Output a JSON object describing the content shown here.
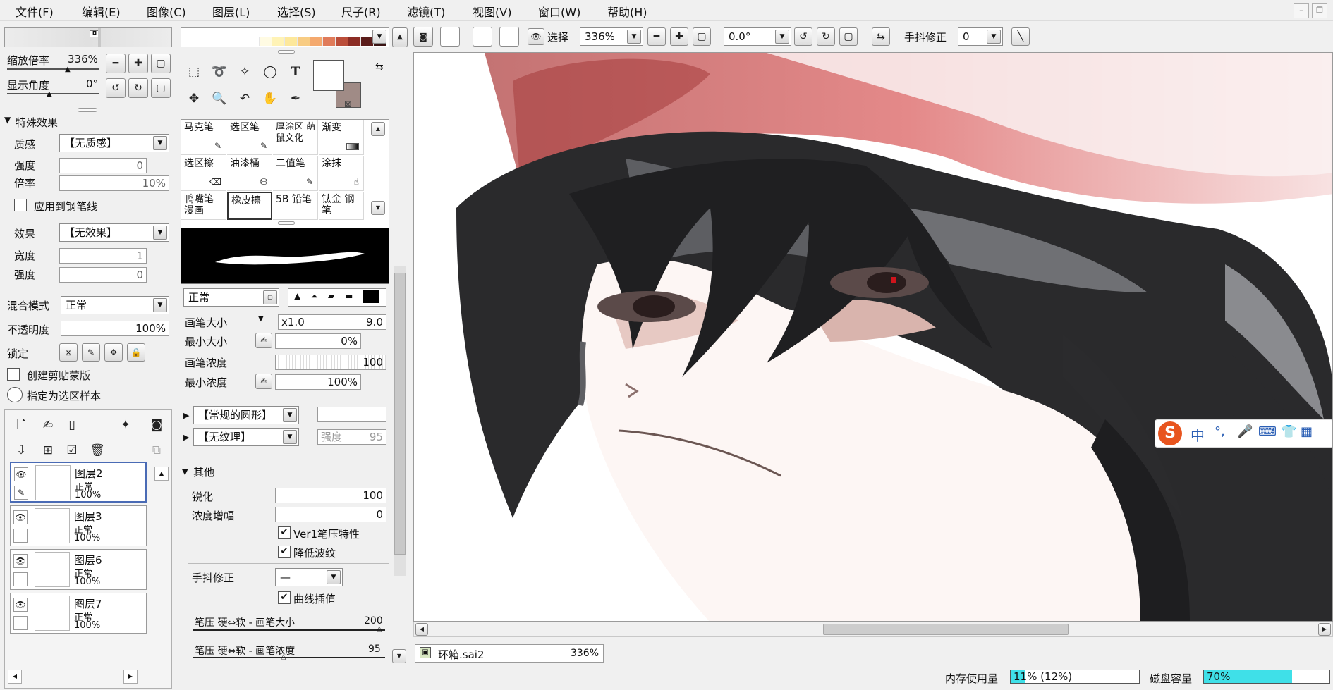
{
  "menu": [
    "文件(F)",
    "编辑(E)",
    "图像(C)",
    "图层(L)",
    "选择(S)",
    "尺子(R)",
    "滤镜(T)",
    "视图(V)",
    "窗口(W)",
    "帮助(H)"
  ],
  "navigator": {
    "zoom_label": "缩放倍率",
    "zoom_value": "336%",
    "angle_label": "显示角度",
    "angle_value": "0°"
  },
  "effects": {
    "header": "特殊效果",
    "texture_label": "质感",
    "texture_value": "【无质感】",
    "strength_label": "强度",
    "strength_value": "0",
    "scale_label": "倍率",
    "scale_value": "10%",
    "apply_label": "应用到钢笔线",
    "effect_label": "效果",
    "effect_value": "【无效果】",
    "width_label": "宽度",
    "width_value": "1",
    "strength2_label": "强度",
    "strength2_value": "0"
  },
  "layer_props": {
    "blend_label": "混合模式",
    "blend_value": "正常",
    "opacity_label": "不透明度",
    "opacity_value": "100%",
    "lock_label": "锁定",
    "clip_label": "创建剪贴蒙版",
    "sample_label": "指定为选区样本"
  },
  "layers": [
    {
      "name": "图层2",
      "mode": "正常",
      "opacity": "100%"
    },
    {
      "name": "图层3",
      "mode": "正常",
      "opacity": "100%"
    },
    {
      "name": "图层6",
      "mode": "正常",
      "opacity": "100%"
    },
    {
      "name": "图层7",
      "mode": "正常",
      "opacity": "100%"
    }
  ],
  "brushes": [
    "马克笔",
    "选区笔",
    "厚涂区 萌鼠文化",
    "渐变",
    "选区擦",
    "油漆桶",
    "二值笔",
    "涂抹",
    "鸭嘴笔 漫画",
    "橡皮擦",
    "5B 铅笔",
    "钛金 钢笔"
  ],
  "brush_settings": {
    "mode": "正常",
    "size_label": "画笔大小",
    "size_mult": "x1.0",
    "size_value": "9.0",
    "min_size_label": "最小大小",
    "min_size_value": "0%",
    "density_label": "画笔浓度",
    "density_value": "100",
    "min_density_label": "最小浓度",
    "min_density_value": "100%",
    "shape": "【常规的圆形】",
    "texture": "【无纹理】",
    "tex_strength_label": "强度",
    "tex_strength_value": "95",
    "other_header": "其他",
    "sharpen_label": "锐化",
    "sharpen_value": "100",
    "gain_label": "浓度增幅",
    "gain_value": "0",
    "ver1_label": "Ver1笔压特性",
    "moire_label": "降低波纹",
    "stab_label": "手抖修正",
    "stab_value": "—",
    "curve_label": "曲线插值",
    "p_size_label": "笔压 硬⇔软 - 画笔大小",
    "p_size_value": "200",
    "p_dens_label": "笔压 硬⇔软 - 画笔浓度",
    "p_dens_value": "95"
  },
  "toolbar": {
    "select_label": "选择",
    "zoom_value": "336%",
    "angle_value": "0.0°",
    "stab_label": "手抖修正",
    "stab_value": "0"
  },
  "document_tab": {
    "name": "环箱.sai2",
    "zoom": "336%"
  },
  "status": {
    "memory_label": "内存使用量",
    "memory_value": "11% (12%)",
    "memory_fill": 0.11,
    "disk_label": "磁盘容量",
    "disk_value": "70%",
    "disk_fill": 0.7
  },
  "ime": {
    "lang": "中",
    "punct": "°,"
  },
  "colors": {
    "swatches": [
      "#fffbe3",
      "#fff3b6",
      "#fde89b",
      "#f8cc83",
      "#f4a96e",
      "#e07b5a",
      "#bb4e3a",
      "#8c2d25",
      "#5c1d1b",
      "#3a1414"
    ],
    "primary": "#ffffff",
    "secondary": "#a08b86"
  }
}
